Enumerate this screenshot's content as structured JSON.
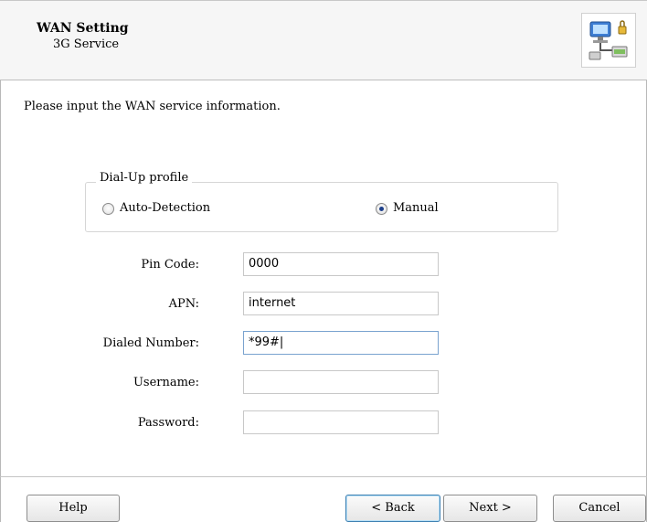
{
  "header": {
    "title": "WAN Setting",
    "subtitle": "3G Service",
    "icon": "network-setup-icon"
  },
  "intro_text": "Please input the WAN service information.",
  "dialup_profile": {
    "legend": "Dial-Up profile",
    "options": [
      {
        "label": "Auto-Detection",
        "selected": false
      },
      {
        "label": "Manual",
        "selected": true
      }
    ]
  },
  "fields": {
    "pin_code": {
      "label": "Pin Code:",
      "value": "0000"
    },
    "apn": {
      "label": "APN:",
      "value": "internet"
    },
    "dialed_number": {
      "label": "Dialed Number:",
      "value": "*99#|"
    },
    "username": {
      "label": "Username:",
      "value": ""
    },
    "password": {
      "label": "Password:",
      "value": ""
    }
  },
  "buttons": {
    "help": "Help",
    "back": "< Back",
    "next": "Next >",
    "cancel": "Cancel"
  }
}
